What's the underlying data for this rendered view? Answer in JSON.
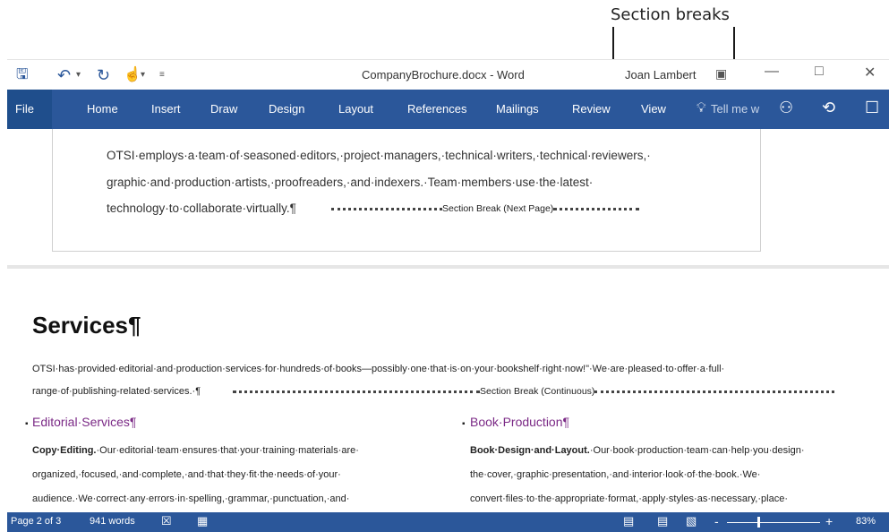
{
  "callout": {
    "label": "Section breaks"
  },
  "titlebar": {
    "doc_title": "CompanyBrochure.docx - Word",
    "user": "Joan Lambert",
    "icons": [
      "save-icon",
      "undo-icon",
      "redo-icon",
      "touch-mode-icon",
      "customize-qat-icon"
    ]
  },
  "ribbon": {
    "file": "File",
    "tabs": [
      "Home",
      "Insert",
      "Draw",
      "Design",
      "Layout",
      "References",
      "Mailings",
      "Review",
      "View"
    ],
    "tell_me": "Tell me w",
    "accent": "#2b579a"
  },
  "page1": {
    "line1": "OTSI·employs·a·team·of·seasoned·editors,·project·managers,·technical·writers,·technical·reviewers,·",
    "line2": "graphic·and·production·artists,·proofreaders,·and·indexers.·Team·members·use·the·latest·",
    "line3": "technology·to·collaborate·virtually.¶",
    "break_label": "Section Break (Next Page)"
  },
  "page2": {
    "heading": "Services¶",
    "para_line1": "OTSI·has·provided·editorial·and·production·services·for·hundreds·of·books—possibly·one·that·is·on·your·bookshelf·right·now!\"·We·are·pleased·to·offer·a·full·",
    "para_line2": "range·of·publishing-related·services.·¶",
    "break_label": "Section Break (Continuous)",
    "left_col": {
      "heading": "Editorial·Services¶",
      "line1_bold": "Copy·Editing.",
      "line1": "·Our·editorial·team·ensures·that·your·training·materials·are·",
      "line2": "organized,·focused,·and·complete,·and·that·they·fit·the·needs·of·your·",
      "line3": "audience.·We·correct·any·errors·in·spelling,·grammar,·punctuation,·and·"
    },
    "right_col": {
      "heading": "Book·Production¶",
      "line1_bold": "Book·Design·and·Layout.",
      "line1": "·Our·book·production·team·can·help·you·design·",
      "line2": "the·cover,·graphic·presentation,·and·interior·look·of·the·book.·We·",
      "line3": "convert·files·to·the·appropriate·format,·apply·styles·as·necessary,·place·"
    }
  },
  "status": {
    "page": "Page 2 of 3",
    "words": "941 words",
    "zoom": "83%",
    "zoom_minus": "-",
    "zoom_plus": "+"
  }
}
